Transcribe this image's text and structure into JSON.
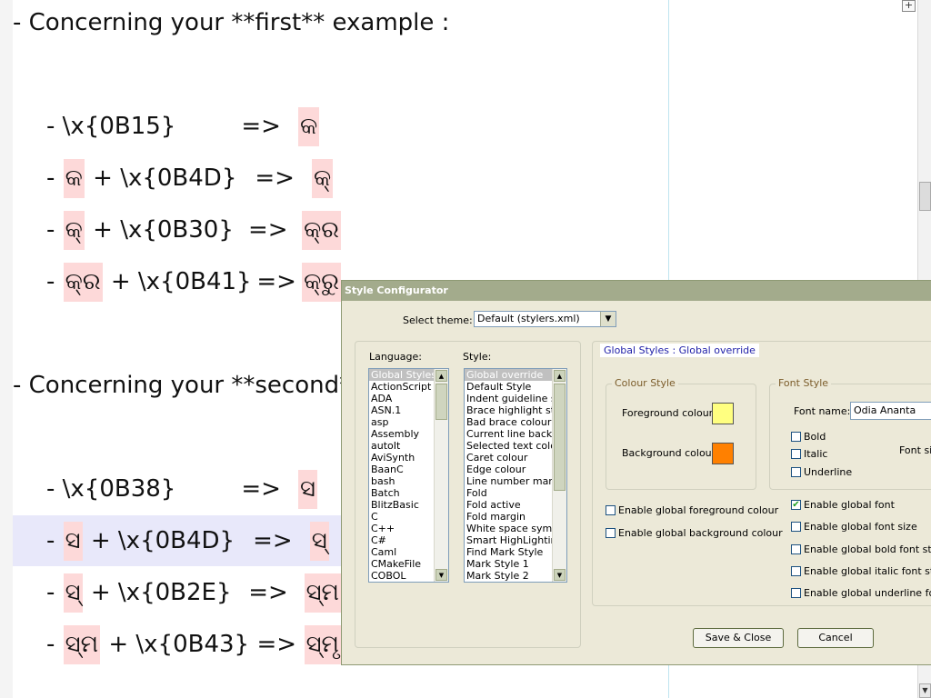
{
  "editor": {
    "heading1": "- Concerning your **first** example :",
    "heading2": "- Concerning your **second**",
    "rows1": [
      {
        "dash": "- ",
        "a": "\\x{0B15}",
        "b": "",
        "arrow": "=>",
        "r": "କ"
      },
      {
        "dash": "- ",
        "a": "କ",
        "b": " + \\x{0B4D}",
        "arrow": "=>",
        "r": "କ୍"
      },
      {
        "dash": "- ",
        "a": "କ୍",
        "b": " + \\x{0B30}",
        "arrow": "=>",
        "r": "କ୍ର"
      },
      {
        "dash": "- ",
        "a": "କ୍ର",
        "b": " + \\x{0B41}",
        "arrow": "=>",
        "r": "କ୍ରୁ"
      }
    ],
    "rows2": [
      {
        "dash": "- ",
        "a": "\\x{0B38}",
        "b": "",
        "arrow": "=>",
        "r": "ସ"
      },
      {
        "dash": "- ",
        "a": "ସ",
        "b": " + \\x{0B4D}",
        "arrow": "=>",
        "r": "ସ୍"
      },
      {
        "dash": "- ",
        "a": "ସ୍",
        "b": " + \\x{0B2E}",
        "arrow": "=>",
        "r": "ସ୍ମ"
      },
      {
        "dash": "- ",
        "a": "ସ୍ମ",
        "b": " + \\x{0B43}",
        "arrow": "=>",
        "r": "ସ୍ମୃ"
      }
    ],
    "fold_icon": "plus-box-icon"
  },
  "dialog": {
    "title": "Style Configurator",
    "select_theme_label": "Select theme:",
    "theme_value": "Default (stylers.xml)",
    "language_label": "Language:",
    "style_label": "Style:",
    "languages": [
      "Global Styles",
      "ActionScript",
      "ADA",
      "ASN.1",
      "asp",
      "Assembly",
      "autoIt",
      "AviSynth",
      "BaanC",
      "bash",
      "Batch",
      "BlitzBasic",
      "C",
      "C++",
      "C#",
      "Caml",
      "CMakeFile",
      "COBOL"
    ],
    "styles": [
      "Global override",
      "Default Style",
      "Indent guideline style",
      "Brace highlight style",
      "Bad brace colour",
      "Current line background",
      "Selected text colour",
      "Caret colour",
      "Edge colour",
      "Line number margin",
      "Fold",
      "Fold active",
      "Fold margin",
      "White space symbol",
      "Smart HighLighting",
      "Find Mark Style",
      "Mark Style 1",
      "Mark Style 2"
    ],
    "header_text": "Global Styles : Global override",
    "colour_style_legend": "Colour Style",
    "foreground_label": "Foreground colour",
    "background_label": "Background colour",
    "foreground_color": "#ffff80",
    "background_color": "#ff8000",
    "font_style_legend": "Font Style",
    "font_name_label": "Font name:",
    "font_name_value": "Odia Ananta",
    "bold_label": "Bold",
    "italic_label": "Italic",
    "underline_label": "Underline",
    "font_size_label": "Font siz",
    "enable_fg": "Enable global foreground colour",
    "enable_bg": "Enable global background colour",
    "enable_font": "Enable global font",
    "enable_font_size": "Enable global font size",
    "enable_bold": "Enable global bold font style",
    "enable_italic": "Enable global italic font style",
    "enable_underline": "Enable global underline font s",
    "save_close": "Save & Close",
    "cancel": "Cancel"
  }
}
